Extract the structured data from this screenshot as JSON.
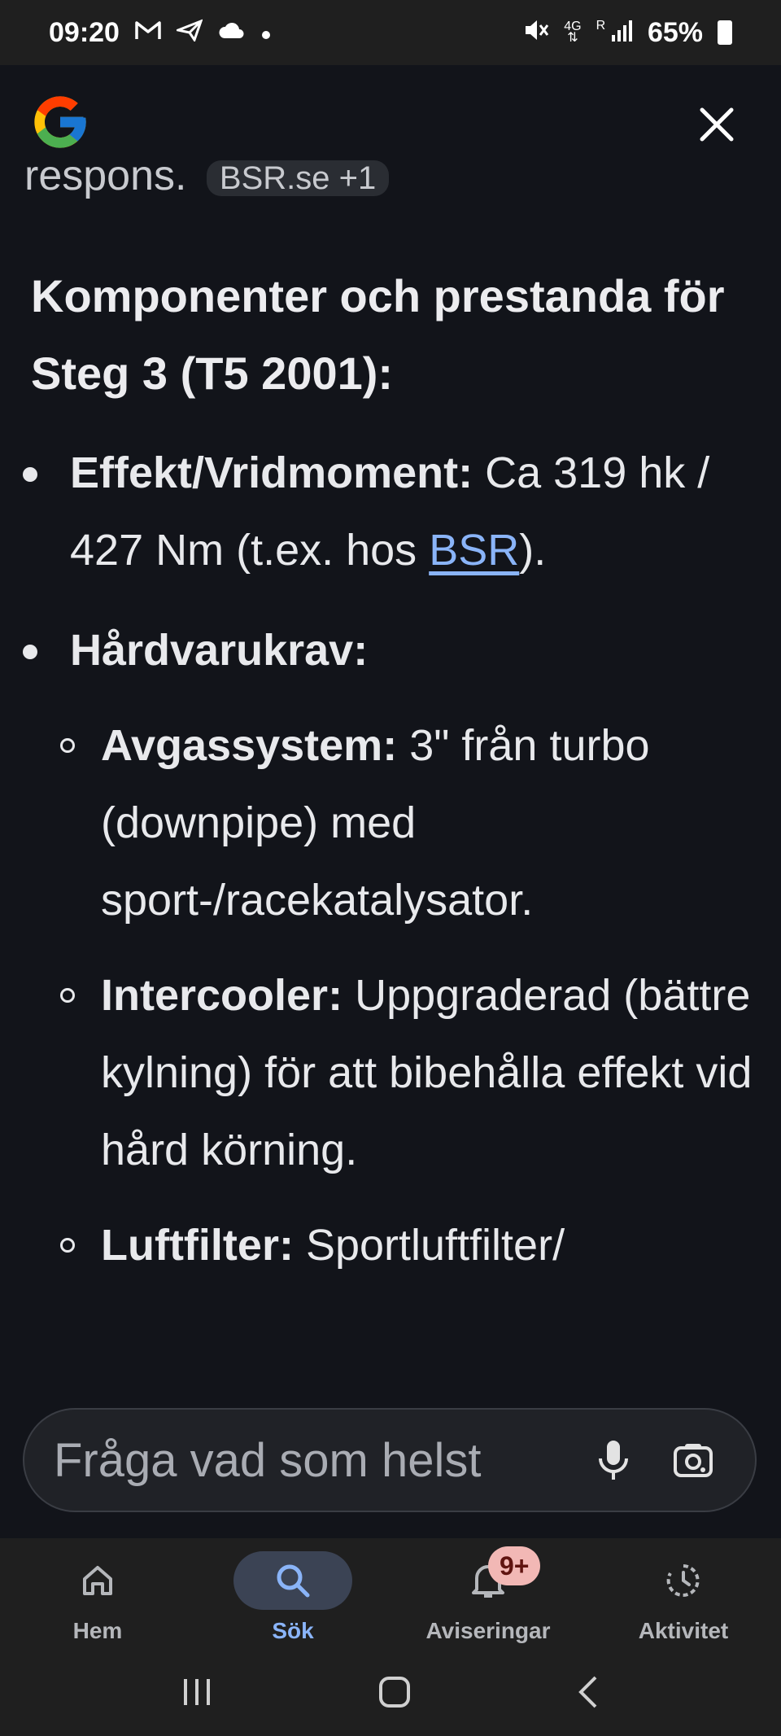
{
  "status_bar": {
    "time": "09:20",
    "left_icons": [
      "gmail-icon",
      "send-icon",
      "cloud-icon",
      "dot-icon"
    ],
    "right_icons": [
      "mute-icon",
      "4g-icon",
      "signal-icon"
    ],
    "network": "4G",
    "roaming": "R",
    "battery": "65%"
  },
  "content": {
    "cut_text": "respons.",
    "cut_chip": "BSR.se +1",
    "heading": "Komponenter och prestanda för Steg 3 (T5 2001):",
    "bullets": [
      {
        "label": "Effekt/Vridmoment:",
        "text": "Ca 319 hk / 427 Nm (t.ex. hos",
        "link": "BSR",
        "after": ")."
      },
      {
        "label": "Hårdvarukrav:"
      }
    ],
    "subbullets": [
      {
        "label": "Avgassystem:",
        "text": "3\" från turbo (downpipe) med sport-/racekatalysator."
      },
      {
        "label": "Intercooler:",
        "text": "Uppgraderad (bättre kylning) för att bibehålla effekt vid hård körning."
      },
      {
        "label": "Luftfilter:",
        "text": "Sportluftfilter/"
      }
    ]
  },
  "ask_bar": {
    "placeholder": "Fråga vad som helst"
  },
  "bottom_nav": {
    "items": [
      {
        "label": "Hem",
        "icon": "home-icon"
      },
      {
        "label": "Sök",
        "icon": "search-icon",
        "active": true
      },
      {
        "label": "Aviseringar",
        "icon": "bell-icon",
        "badge": "9+"
      },
      {
        "label": "Aktivitet",
        "icon": "activity-icon"
      }
    ]
  },
  "colors": {
    "background": "#12141a",
    "link": "#8ab4f8",
    "active": "#8ab4f8",
    "badge": "#f2b8b5"
  }
}
